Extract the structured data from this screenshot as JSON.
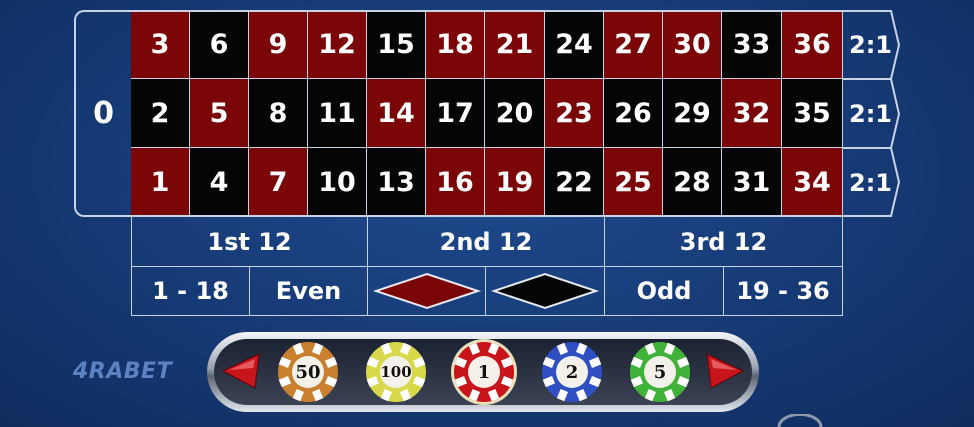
{
  "table": {
    "zero": "0",
    "rows": [
      [
        {
          "n": "3",
          "c": "red"
        },
        {
          "n": "6",
          "c": "black"
        },
        {
          "n": "9",
          "c": "red"
        },
        {
          "n": "12",
          "c": "red"
        },
        {
          "n": "15",
          "c": "black"
        },
        {
          "n": "18",
          "c": "red"
        },
        {
          "n": "21",
          "c": "red"
        },
        {
          "n": "24",
          "c": "black"
        },
        {
          "n": "27",
          "c": "red"
        },
        {
          "n": "30",
          "c": "red"
        },
        {
          "n": "33",
          "c": "black"
        },
        {
          "n": "36",
          "c": "red"
        }
      ],
      [
        {
          "n": "2",
          "c": "black"
        },
        {
          "n": "5",
          "c": "red"
        },
        {
          "n": "8",
          "c": "black"
        },
        {
          "n": "11",
          "c": "black"
        },
        {
          "n": "14",
          "c": "red"
        },
        {
          "n": "17",
          "c": "black"
        },
        {
          "n": "20",
          "c": "black"
        },
        {
          "n": "23",
          "c": "red"
        },
        {
          "n": "26",
          "c": "black"
        },
        {
          "n": "29",
          "c": "black"
        },
        {
          "n": "32",
          "c": "red"
        },
        {
          "n": "35",
          "c": "black"
        }
      ],
      [
        {
          "n": "1",
          "c": "red"
        },
        {
          "n": "4",
          "c": "black"
        },
        {
          "n": "7",
          "c": "red"
        },
        {
          "n": "10",
          "c": "black"
        },
        {
          "n": "13",
          "c": "black"
        },
        {
          "n": "16",
          "c": "red"
        },
        {
          "n": "19",
          "c": "red"
        },
        {
          "n": "22",
          "c": "black"
        },
        {
          "n": "25",
          "c": "red"
        },
        {
          "n": "28",
          "c": "black"
        },
        {
          "n": "31",
          "c": "black"
        },
        {
          "n": "34",
          "c": "red"
        }
      ]
    ],
    "column_bets": [
      "2:1",
      "2:1",
      "2:1"
    ],
    "dozens": [
      "1st 12",
      "2nd 12",
      "3rd 12"
    ],
    "even_money": {
      "low": "1 - 18",
      "even": "Even",
      "red_diamond": "red-diamond-icon",
      "black_diamond": "black-diamond-icon",
      "odd": "Odd",
      "high": "19 - 36"
    }
  },
  "brand": {
    "logo": "4RABET"
  },
  "chips": [
    {
      "value": "50",
      "ring": "#c9812f",
      "selected": false
    },
    {
      "value": "100",
      "ring": "#d7d84a",
      "selected": false
    },
    {
      "value": "1",
      "ring": "#c8141b",
      "selected": true
    },
    {
      "value": "2",
      "ring": "#2f4fc2",
      "selected": false
    },
    {
      "value": "5",
      "ring": "#3fb23a",
      "selected": false
    }
  ],
  "colors": {
    "red": "#7b0608",
    "black": "#050505",
    "felt": "#163a75",
    "line": "#c9d3e6"
  }
}
